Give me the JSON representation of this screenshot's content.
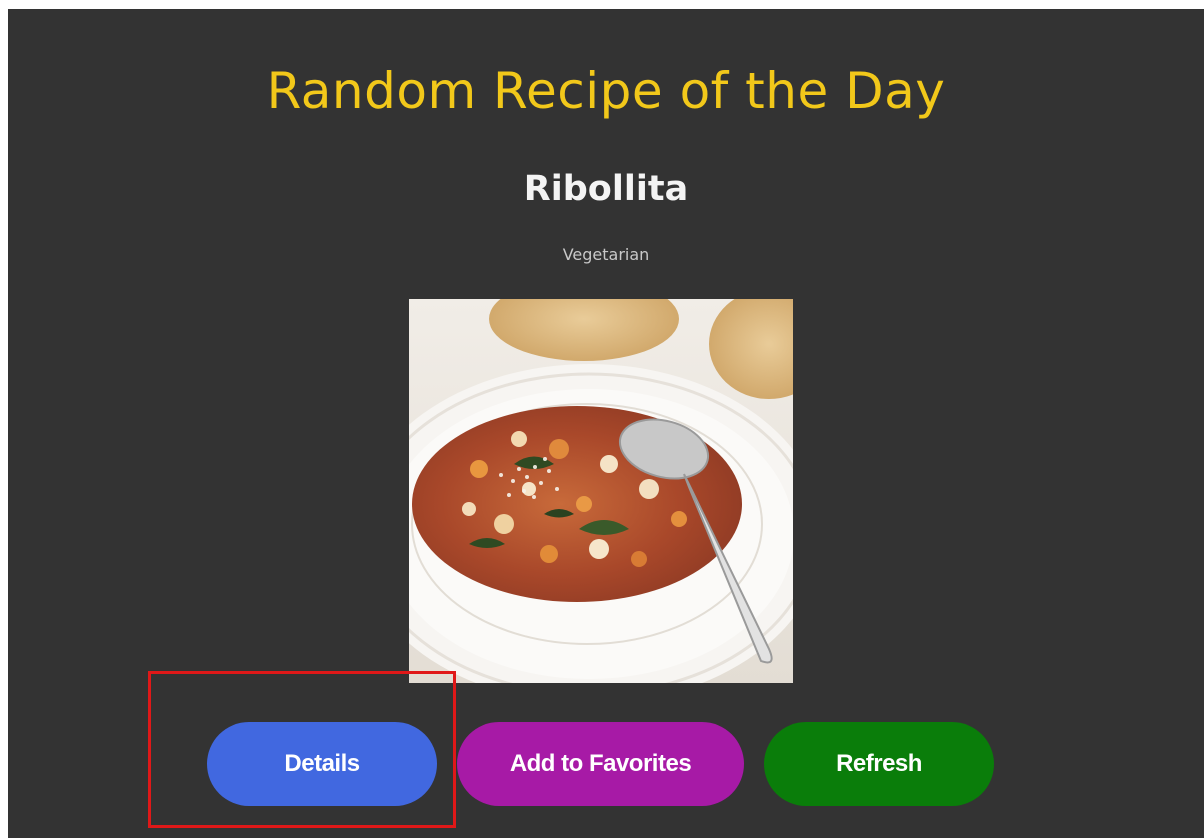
{
  "page": {
    "title": "Random Recipe of the Day",
    "background_color": "#333333",
    "title_color": "#f2c81a"
  },
  "recipe": {
    "name": "Ribollita",
    "category": "Vegetarian",
    "image_icon": "recipe-photo"
  },
  "buttons": {
    "details": {
      "label": "Details",
      "color": "#4168e0"
    },
    "favorites": {
      "label": "Add to Favorites",
      "color": "#a71aa6"
    },
    "refresh": {
      "label": "Refresh",
      "color": "#0a7d0a"
    }
  },
  "annotation": {
    "highlight_color": "#e01818"
  }
}
